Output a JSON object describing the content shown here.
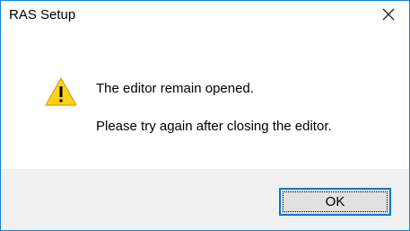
{
  "window": {
    "title": "RAS Setup",
    "close_icon": "close-icon",
    "border_color": "#1883d7"
  },
  "message": {
    "icon": "warning-icon",
    "icon_color": "#fcd116",
    "line1": "The editor remain opened.",
    "line2": "Please try again after closing the editor."
  },
  "buttons": {
    "ok_label": "OK",
    "focus_color": "#0078d7"
  }
}
